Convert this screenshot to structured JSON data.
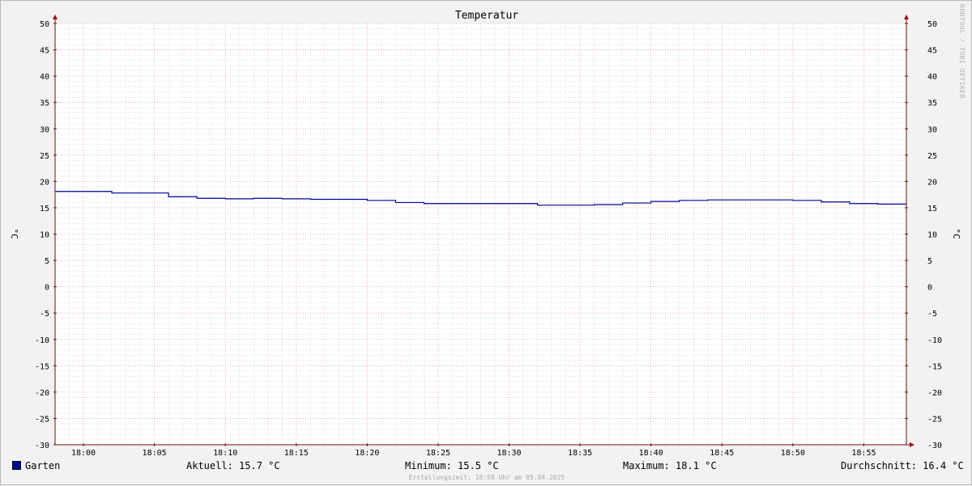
{
  "title": "Temperatur",
  "watermark": "RRDTOOL / TOBI OETIKER",
  "footer": "Erstellungszeit: 18:58 Uhr am 05.04.2025",
  "legend": {
    "series_name": "Garten",
    "aktuell": "Aktuell: 15.7 °C",
    "minimum": "Minimum: 15.5 °C",
    "maximum": "Maximum: 18.1 °C",
    "durchschnitt": "Durchschnitt: 16.4 °C"
  },
  "colors": {
    "series": "#000099",
    "plot_bg": "#ffffff",
    "minor_grid": "#c8c8c8",
    "major_grid": "#e8a0a0",
    "axis": "#6b1010"
  },
  "chart_data": {
    "type": "line",
    "title": "Temperatur",
    "ylabel": "°C",
    "ylabel_right": "°C",
    "ylim": [
      -30,
      50
    ],
    "yticks": [
      50,
      45,
      40,
      35,
      30,
      25,
      20,
      15,
      10,
      5,
      0,
      -5,
      -10,
      -15,
      -20,
      -25,
      -30
    ],
    "xlim": [
      "17:58",
      "18:58"
    ],
    "xticks": [
      "18:00",
      "18:05",
      "18:10",
      "18:15",
      "18:20",
      "18:25",
      "18:30",
      "18:35",
      "18:40",
      "18:45",
      "18:50",
      "18:55"
    ],
    "grid": true,
    "legend_position": "bottom",
    "series": [
      {
        "name": "Garten",
        "step": true,
        "x": [
          "17:58",
          "18:02",
          "18:06",
          "18:08",
          "18:10",
          "18:12",
          "18:14",
          "18:16",
          "18:18",
          "18:20",
          "18:22",
          "18:24",
          "18:26",
          "18:28",
          "18:30",
          "18:32",
          "18:34",
          "18:36",
          "18:38",
          "18:40",
          "18:42",
          "18:44",
          "18:46",
          "18:48",
          "18:50",
          "18:52",
          "18:54",
          "18:56"
        ],
        "y": [
          18.1,
          17.8,
          17.1,
          16.8,
          16.7,
          16.8,
          16.7,
          16.6,
          16.6,
          16.4,
          16.0,
          15.8,
          15.8,
          15.8,
          15.8,
          15.5,
          15.5,
          15.6,
          15.9,
          16.2,
          16.4,
          16.5,
          16.5,
          16.5,
          16.4,
          16.1,
          15.8,
          15.7
        ]
      }
    ]
  }
}
